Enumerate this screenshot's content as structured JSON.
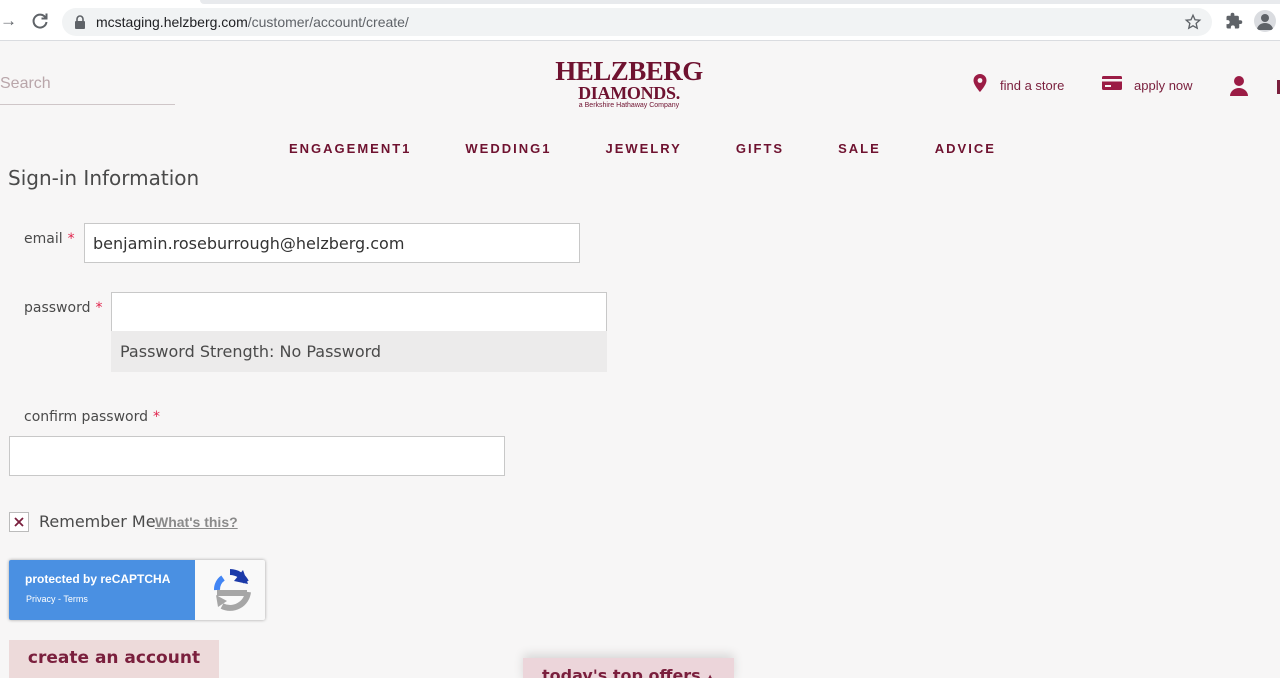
{
  "browser": {
    "url_host": "mcstaging.helzberg.com",
    "url_path": "/customer/account/create/"
  },
  "header": {
    "search_placeholder": "Search",
    "logo_line1": "HELZBERG",
    "logo_line2": "DIAMONDS.",
    "logo_line3": "a Berkshire Hathaway Company",
    "find_store": "find a store",
    "apply_now": "apply now",
    "brand_color": "#6f1230"
  },
  "nav": {
    "items": [
      "ENGAGEMENT1",
      "WEDDING1",
      "JEWELRY",
      "GIFTS",
      "SALE",
      "ADVICE"
    ]
  },
  "form": {
    "title": "Sign-in Information",
    "required_mark": "*",
    "email_label": "email",
    "email_value": "benjamin.roseburrough@helzberg.com",
    "password_label": "password",
    "password_value": "",
    "password_strength": "Password Strength: No Password",
    "confirm_label": "confirm password",
    "confirm_value": "",
    "remember_label": "Remember Me",
    "remember_checked": true,
    "whats_this": "What's this?",
    "recaptcha_line1": "protected by reCAPTCHA",
    "recaptcha_line2": "Privacy - Terms",
    "submit_label": "create an account"
  },
  "offers": {
    "label": "today's top offers"
  }
}
